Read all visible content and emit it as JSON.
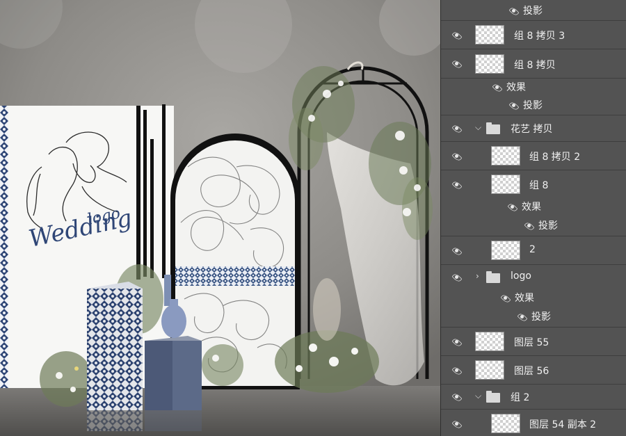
{
  "canvas": {
    "logo_text": "logo",
    "wedding_text": "Wedding"
  },
  "layers": [
    {
      "label": "投影",
      "kind": "effect-sub"
    },
    {
      "label": "组 8 拷贝 3",
      "kind": "layer"
    },
    {
      "label": "组 8 拷贝",
      "kind": "layer"
    },
    {
      "label": "效果",
      "kind": "effect"
    },
    {
      "label": "投影",
      "kind": "effect-sub"
    },
    {
      "label": "花艺 拷贝",
      "kind": "group-open"
    },
    {
      "label": "组 8 拷贝 2",
      "kind": "layer-indent"
    },
    {
      "label": "组 8",
      "kind": "layer-indent"
    },
    {
      "label": "效果",
      "kind": "effect-indent"
    },
    {
      "label": "投影",
      "kind": "effect-sub-indent"
    },
    {
      "label": "2",
      "kind": "layer-indent"
    },
    {
      "label": "logo",
      "kind": "group-closed"
    },
    {
      "label": "效果",
      "kind": "effect-indent"
    },
    {
      "label": "投影",
      "kind": "effect-sub-indent"
    },
    {
      "label": "图层 55",
      "kind": "layer"
    },
    {
      "label": "图层 56",
      "kind": "layer"
    },
    {
      "label": "组 2",
      "kind": "group-open"
    },
    {
      "label": "图层 54 副本 2",
      "kind": "layer-indent"
    }
  ],
  "colors": {
    "panel_bg": "#535353",
    "accent_navy": "#2f4676",
    "canvas_bg": "#8c8a86"
  }
}
